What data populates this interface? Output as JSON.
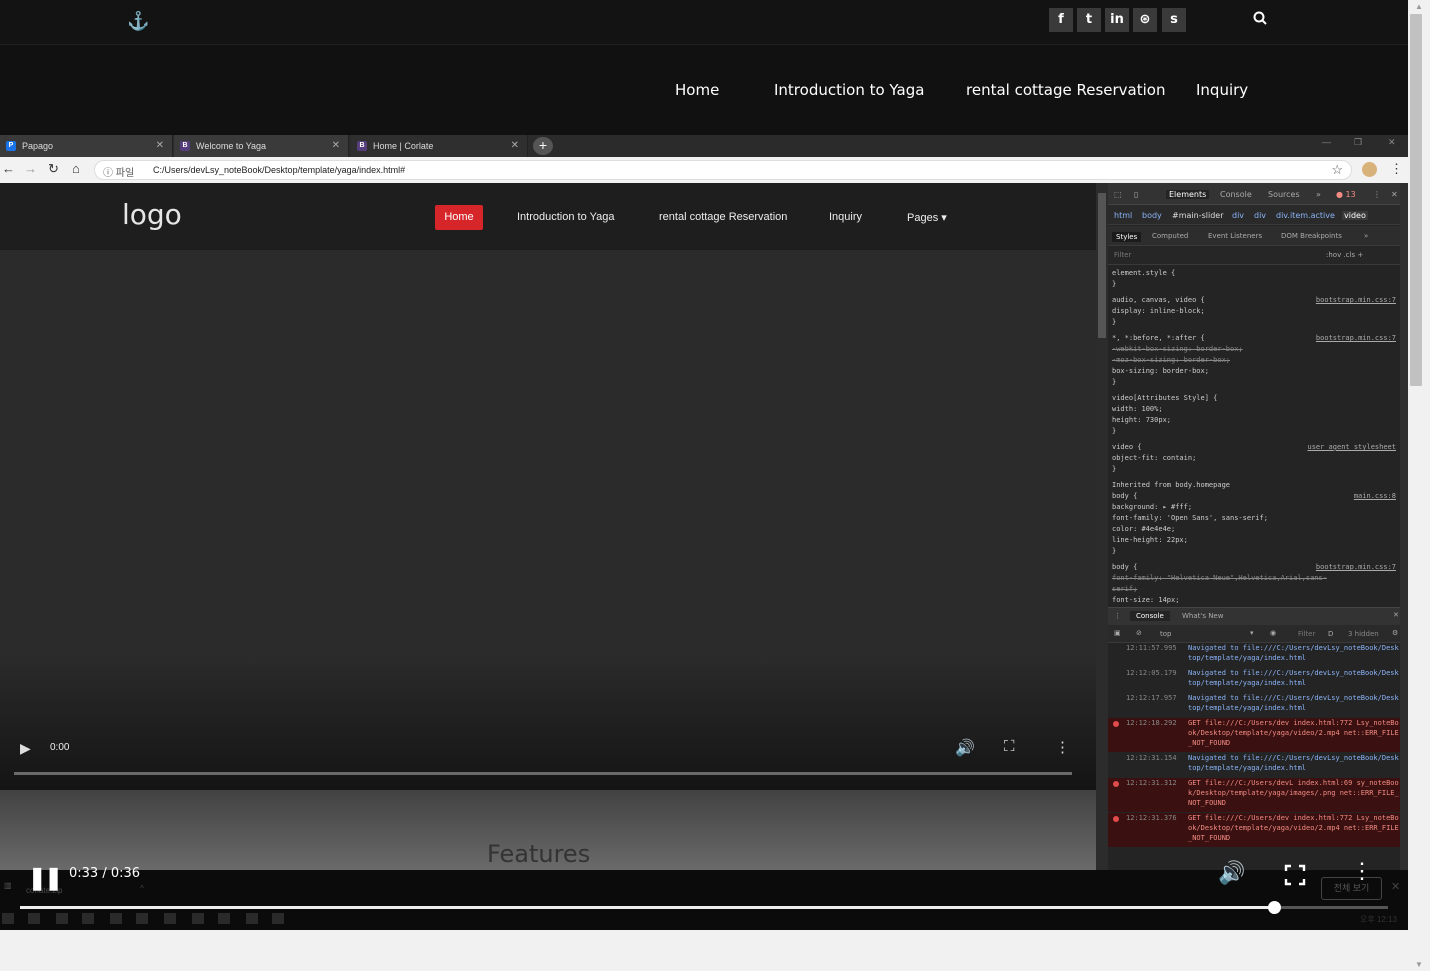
{
  "header": {
    "anchor_icon": "anchor-icon",
    "social": [
      {
        "name": "facebook",
        "glyph": "f"
      },
      {
        "name": "twitter",
        "glyph": "t"
      },
      {
        "name": "linkedin",
        "glyph": "in"
      },
      {
        "name": "dribbble",
        "glyph": "⊛"
      },
      {
        "name": "skype",
        "glyph": "s"
      }
    ],
    "search_icon": "🔍"
  },
  "nav": {
    "items": [
      "Home",
      "Introduction to Yaga",
      "rental cottage Reservation",
      "Inquiry"
    ]
  },
  "browser": {
    "tabs": [
      {
        "title": "Papago",
        "favicon": "P",
        "color": "#1a73e8"
      },
      {
        "title": "Welcome to Yaga",
        "favicon": "B",
        "color": "#563d7c"
      },
      {
        "title": "Home | Corlate",
        "favicon": "B",
        "color": "#563d7c"
      }
    ],
    "new_tab": "+",
    "address": {
      "info_label": "ⓘ 파일",
      "url": "C:/Users/devLsy_noteBook/Desktop/template/yaga/index.html#"
    }
  },
  "inner_page": {
    "logo_alt": "logo",
    "nav": [
      "Home",
      "Introduction to Yaga",
      "rental cottage Reservation",
      "Inquiry",
      "Pages ▾"
    ],
    "video_time": "0:00",
    "features_heading": "Features"
  },
  "devtools": {
    "tabs": [
      "Elements",
      "Console",
      "Sources",
      "»"
    ],
    "error_count": "13",
    "breadcrumb": [
      "html",
      "body",
      "#main-slider",
      "div",
      "div",
      "div.item.active",
      "video"
    ],
    "subtabs": [
      "Styles",
      "Computed",
      "Event Listeners",
      "DOM Breakpoints",
      "»"
    ],
    "filter_placeholder": "Filter",
    "filter_tools": ":hov  .cls  +",
    "styles": [
      {
        "text": "element.style {",
        "src": ""
      },
      {
        "text": "}",
        "src": ""
      },
      {
        "text": "audio, canvas, video {",
        "src": "bootstrap.min.css:7"
      },
      {
        "text": "  display: inline-block;",
        "src": ""
      },
      {
        "text": "}",
        "src": ""
      },
      {
        "text": "*, *:before, *:after {",
        "src": "bootstrap.min.css:7"
      },
      {
        "text": "  -webkit-box-sizing: border-box;",
        "src": "",
        "strike": true
      },
      {
        "text": "  -moz-box-sizing: border-box;",
        "src": "",
        "strike": true
      },
      {
        "text": "  box-sizing: border-box;",
        "src": ""
      },
      {
        "text": "}",
        "src": ""
      },
      {
        "text": "video[Attributes Style] {",
        "src": ""
      },
      {
        "text": "  width: 100%;",
        "src": ""
      },
      {
        "text": "  height: 730px;",
        "src": ""
      },
      {
        "text": "}",
        "src": ""
      },
      {
        "text": "video {",
        "src": "user agent stylesheet"
      },
      {
        "text": "  object-fit: contain;",
        "src": ""
      },
      {
        "text": "}",
        "src": ""
      },
      {
        "text": "Inherited from body.homepage",
        "src": ""
      },
      {
        "text": "body {",
        "src": "main.css:8"
      },
      {
        "text": "  background: ▸ #fff;",
        "src": ""
      },
      {
        "text": "  font-family: 'Open Sans', sans-serif;",
        "src": ""
      },
      {
        "text": "  color: #4e4e4e;",
        "src": ""
      },
      {
        "text": "  line-height: 22px;",
        "src": ""
      },
      {
        "text": "}",
        "src": ""
      },
      {
        "text": "body {",
        "src": "bootstrap.min.css:7"
      },
      {
        "text": "  font-family: \"Helvetica Neue\",Helvetica,Arial,sans-",
        "src": "",
        "strike": true
      },
      {
        "text": "      serif;",
        "src": "",
        "strike": true
      },
      {
        "text": "  font-size: 14px;",
        "src": ""
      }
    ],
    "console_tabs": [
      "Console",
      "What's New"
    ],
    "console_context": "top",
    "console_filter": "Filter",
    "console_levels": "D",
    "console_hidden": "3 hidden",
    "logs": [
      {
        "time": "12:11:57.995",
        "msg": "Navigated to file:///C:/Users/devLsy_noteBook/Desktop/template/yaga/index.html",
        "err": false
      },
      {
        "time": "12:12:05.179",
        "msg": "Navigated to file:///C:/Users/devLsy_noteBook/Desktop/template/yaga/index.html",
        "err": false
      },
      {
        "time": "12:12:17.957",
        "msg": "Navigated to file:///C:/Users/devLsy_noteBook/Desktop/template/yaga/index.html",
        "err": false
      },
      {
        "time": "12:12:18.292",
        "msg": "GET file:///C:/Users/dev index.html:772 Lsy_noteBook/Desktop/template/yaga/video/2.mp4 net::ERR_FILE_NOT_FOUND",
        "err": true
      },
      {
        "time": "12:12:31.154",
        "msg": "Navigated to file:///C:/Users/devLsy_noteBook/Desktop/template/yaga/index.html",
        "err": false
      },
      {
        "time": "12:12:31.312",
        "msg": "GET file:///C:/Users/devL index.html:69 sy_noteBook/Desktop/template/yaga/images/.png net::ERR_FILE_NOT_FOUND",
        "err": true
      },
      {
        "time": "12:12:31.376",
        "msg": "GET file:///C:/Users/dev index.html:772 Lsy_noteBook/Desktop/template/yaga/video/2.mp4 net::ERR_FILE_NOT_FOUND",
        "err": true
      }
    ]
  },
  "player": {
    "time": "0:33 / 0:36",
    "progress": 0.917
  },
  "download_bar": {
    "file": "corlate.zip",
    "full_view": "전체 보기"
  },
  "taskbar": {
    "clock": "오후 12:13"
  },
  "colors": {
    "accent_red": "#d7262a",
    "page_bg": "#111111"
  }
}
